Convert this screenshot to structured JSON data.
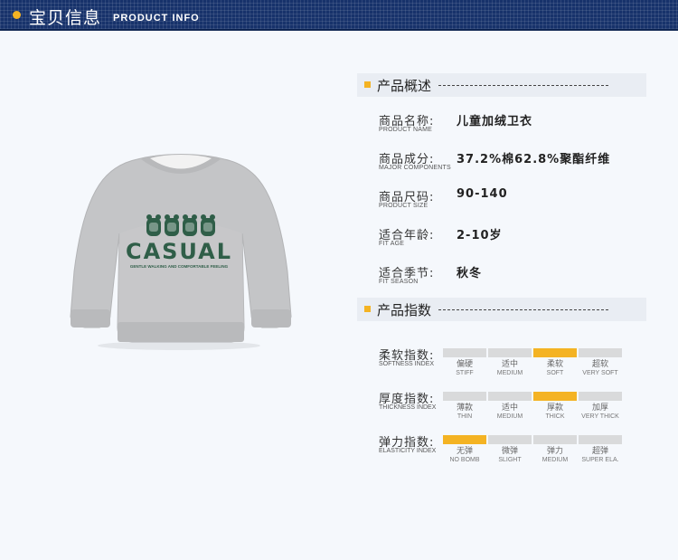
{
  "header": {
    "title": "宝贝信息",
    "subtitle": "PRODUCT INFO"
  },
  "product_image": {
    "icon": "sweatshirt-image",
    "print_text": "CASUAL",
    "print_small_text": "GENTLE WALKING AND COMFORTABLE FEELING",
    "colors": {
      "fabric": "#c4c5c7",
      "print": "#2f5e48",
      "collar": "#f2f2f2"
    }
  },
  "overview": {
    "title": "产品概述",
    "rows": [
      {
        "zh": "商品名称:",
        "en": "PRODUCT NAME",
        "value": "儿童加绒卫衣"
      },
      {
        "zh": "商品成分:",
        "en": "MAJOR COMPONENTS",
        "value": "37.2%棉62.8%聚酯纤维"
      },
      {
        "zh": "商品尺码:",
        "en": "PRODUCT SIZE",
        "value": "90-140"
      },
      {
        "zh": "适合年龄:",
        "en": "FIT AGE",
        "value": "2-10岁"
      },
      {
        "zh": "适合季节:",
        "en": "FIT SEASON",
        "value": "秋冬"
      }
    ]
  },
  "index": {
    "title": "产品指数",
    "rows": [
      {
        "zh": "柔软指数:",
        "en": "SOFTNESS INDEX",
        "selected": 2,
        "levels": [
          {
            "zh": "偏硬",
            "en": "STIFF"
          },
          {
            "zh": "适中",
            "en": "MEDIUM"
          },
          {
            "zh": "柔软",
            "en": "SOFT"
          },
          {
            "zh": "超软",
            "en": "VERY SOFT"
          }
        ]
      },
      {
        "zh": "厚度指数:",
        "en": "THICKNESS INDEX",
        "selected": 2,
        "levels": [
          {
            "zh": "薄款",
            "en": "THIN"
          },
          {
            "zh": "适中",
            "en": "MEDIUM"
          },
          {
            "zh": "厚款",
            "en": "THICK"
          },
          {
            "zh": "加厚",
            "en": "VERY THICK"
          }
        ]
      },
      {
        "zh": "弹力指数:",
        "en": "ELASTICITY INDEX",
        "selected": 0,
        "levels": [
          {
            "zh": "无弹",
            "en": "NO BOMB"
          },
          {
            "zh": "微弹",
            "en": "SLIGHT"
          },
          {
            "zh": "弹力",
            "en": "MEDIUM"
          },
          {
            "zh": "超弹",
            "en": "SUPER ELA."
          }
        ]
      }
    ]
  },
  "colors": {
    "header": "#17326b",
    "accent": "#f4b323",
    "inactive_bar": "#d9dadb"
  }
}
